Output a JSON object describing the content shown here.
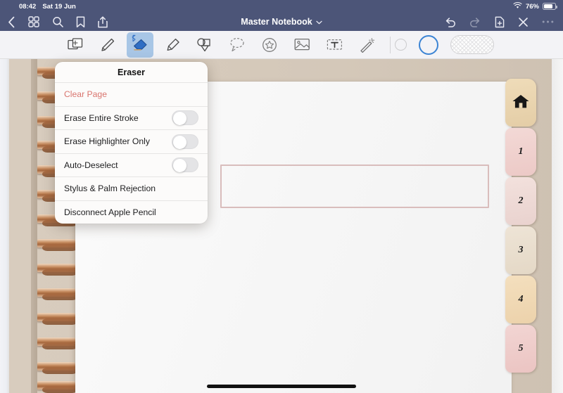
{
  "status_bar": {
    "time": "08:42",
    "date": "Sat 19 Jun",
    "wifi_icon": "wifi-icon",
    "battery_percent": "76%",
    "battery_icon": "battery-icon"
  },
  "nav_bar": {
    "title": "Master Notebook",
    "title_chevron_icon": "chevron-down-icon",
    "left_icons": [
      {
        "name": "back-icon",
        "glyph": "‹"
      },
      {
        "name": "grid-view-icon",
        "glyph": "grid"
      },
      {
        "name": "search-icon",
        "glyph": "search"
      },
      {
        "name": "bookmark-icon",
        "glyph": "bookmark"
      },
      {
        "name": "share-icon",
        "glyph": "share"
      }
    ],
    "right_icons": [
      {
        "name": "undo-icon",
        "glyph": "undo",
        "enabled": true
      },
      {
        "name": "redo-icon",
        "glyph": "redo",
        "enabled": false
      },
      {
        "name": "add-page-icon",
        "glyph": "add-page",
        "enabled": true
      },
      {
        "name": "close-icon",
        "glyph": "✕",
        "enabled": true
      },
      {
        "name": "more-options-icon",
        "glyph": "•••",
        "enabled": true
      }
    ]
  },
  "tool_bar": {
    "tools": [
      {
        "name": "tool-page-insert",
        "selected": false
      },
      {
        "name": "tool-pen",
        "selected": false
      },
      {
        "name": "tool-eraser",
        "selected": true,
        "bluetooth_badge": true
      },
      {
        "name": "tool-highlighter",
        "selected": false
      },
      {
        "name": "tool-shapes",
        "selected": false
      },
      {
        "name": "tool-lasso",
        "selected": false
      },
      {
        "name": "tool-sticker",
        "selected": false
      },
      {
        "name": "tool-image",
        "selected": false
      },
      {
        "name": "tool-textbox",
        "selected": false
      },
      {
        "name": "tool-magic-wand",
        "selected": false
      }
    ],
    "size_small_selected": false,
    "size_large_selected": true,
    "swatch_name": "transparency-swatch",
    "accent_color": "#3b84d4",
    "selection_color": "#a8c6e6"
  },
  "eraser_popover": {
    "title": "Eraser",
    "rows": [
      {
        "label": "Clear Page",
        "type": "action",
        "destructive": true
      },
      {
        "label": "Erase Entire Stroke",
        "type": "toggle",
        "value": false
      },
      {
        "label": "Erase Highlighter Only",
        "type": "toggle",
        "value": false
      },
      {
        "label": "Auto-Deselect",
        "type": "toggle",
        "value": false
      },
      {
        "label": "Stylus & Palm Rejection",
        "type": "action",
        "destructive": false
      },
      {
        "label": "Disconnect Apple Pencil",
        "type": "action",
        "destructive": false
      }
    ],
    "destructive_color": "#d9756e"
  },
  "notebook": {
    "page_shape_color": "#d9bdbc",
    "index_tabs": [
      {
        "label": "",
        "icon": "home-icon",
        "style": "tab-home"
      },
      {
        "label": "1",
        "icon": "",
        "style": "tab-1"
      },
      {
        "label": "2",
        "icon": "",
        "style": "tab-2"
      },
      {
        "label": "3",
        "icon": "",
        "style": "tab-3"
      },
      {
        "label": "4",
        "icon": "",
        "style": "tab-4"
      },
      {
        "label": "5",
        "icon": "",
        "style": "tab-5"
      }
    ]
  },
  "home_indicator": "home-indicator"
}
